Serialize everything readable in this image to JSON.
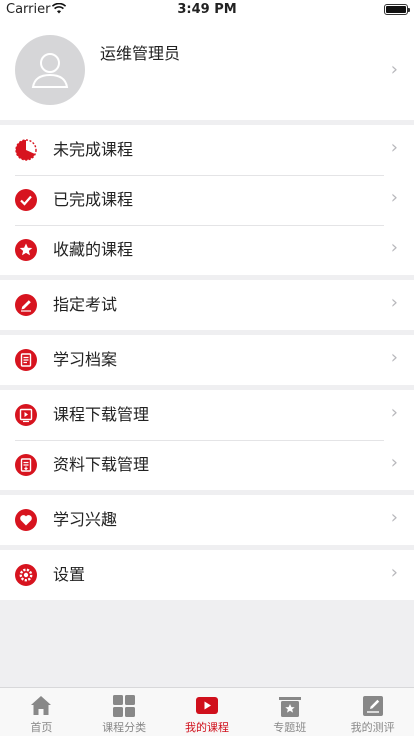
{
  "status_bar": {
    "carrier": "Carrier",
    "time": "3:49 PM"
  },
  "profile": {
    "name": "运维管理员"
  },
  "menu_groups": [
    {
      "items": [
        {
          "name": "unfinished-courses",
          "label": "未完成课程",
          "icon": "pie-progress-icon"
        },
        {
          "name": "completed-courses",
          "label": "已完成课程",
          "icon": "checkmark-icon"
        },
        {
          "name": "favorite-courses",
          "label": "收藏的课程",
          "icon": "star-icon"
        }
      ]
    },
    {
      "items": [
        {
          "name": "assigned-exams",
          "label": "指定考试",
          "icon": "pencil-icon"
        }
      ]
    },
    {
      "items": [
        {
          "name": "learning-records",
          "label": "学习档案",
          "icon": "document-icon"
        }
      ]
    },
    {
      "items": [
        {
          "name": "course-downloads",
          "label": "课程下载管理",
          "icon": "video-download-icon"
        },
        {
          "name": "material-downloads",
          "label": "资料下载管理",
          "icon": "file-download-icon"
        }
      ]
    },
    {
      "items": [
        {
          "name": "learning-interests",
          "label": "学习兴趣",
          "icon": "heart-icon"
        }
      ]
    },
    {
      "items": [
        {
          "name": "settings",
          "label": "设置",
          "icon": "gear-icon"
        }
      ]
    }
  ],
  "tabbar": {
    "tabs": [
      {
        "label": "首页",
        "icon": "home-icon"
      },
      {
        "label": "课程分类",
        "icon": "grid-icon"
      },
      {
        "label": "我的课程",
        "icon": "play-icon",
        "active": true
      },
      {
        "label": "专题班",
        "icon": "badge-icon"
      },
      {
        "label": "我的测评",
        "icon": "edit-icon"
      }
    ]
  },
  "colors": {
    "accent": "#d0101c",
    "icon_red": "#d7141f",
    "inactive": "#888888",
    "chevron": "#b8b8bc"
  }
}
